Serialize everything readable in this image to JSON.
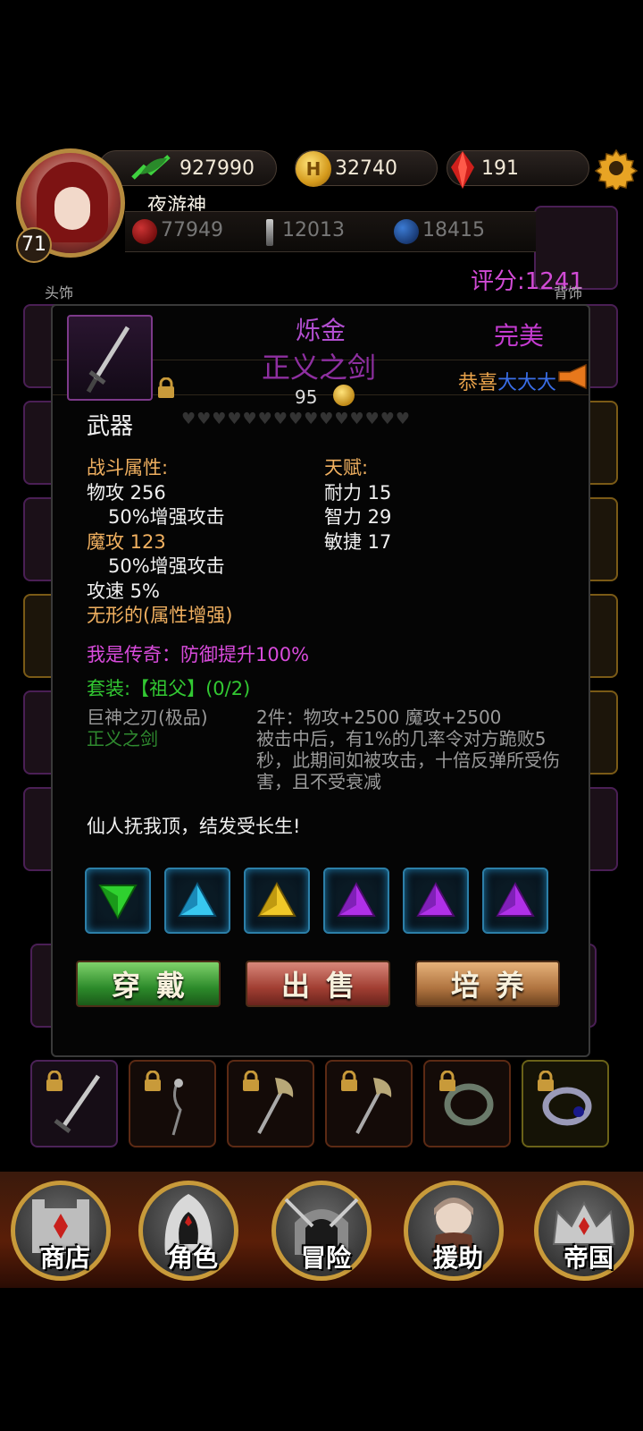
{
  "resources": {
    "exp": "927990",
    "gold": "32740",
    "gold_icon_letter": "H",
    "gems": "191"
  },
  "player": {
    "name": "夜游神",
    "level": "71",
    "hp": "77949",
    "attack": "12013",
    "mana": "18415",
    "score": "评分:1241"
  },
  "slot_labels": {
    "head": "头饰",
    "back": "背饰"
  },
  "item": {
    "type_top": "烁金",
    "name": "正义之剑",
    "quality": "完美",
    "congrats_prefix": "恭喜",
    "congrats_name": "大大大",
    "level_req": "95",
    "slot_type": "武器",
    "hearts": "♥♥♥♥♥♥♥♥♥♥♥♥♥♥♥",
    "combat_title": "战斗属性:",
    "combat_stats": [
      {
        "text": "物攻 256",
        "style": "white"
      },
      {
        "text": "50%增强攻击",
        "style": "white indent"
      },
      {
        "text": "魔攻 123",
        "style": "orange"
      },
      {
        "text": "50%增强攻击",
        "style": "white indent"
      },
      {
        "text": "攻速 5%",
        "style": "white"
      },
      {
        "text": "无形的(属性增强)",
        "style": "orange"
      }
    ],
    "talent_title": "天赋:",
    "talents": [
      "耐力 15",
      "智力 29",
      "敏捷 17"
    ],
    "legend_line": "我是传奇：防御提升100%",
    "set_line": "套装:【祖父】(0/2)",
    "set_item_1": "巨神之刃(极品)",
    "set_item_2": "正义之剑",
    "set_effect": "2件：物攻+2500 魔攻+2500\n被击中后，有1%的几率令对方跪败5秒，此期间如被攻击，十倍反弹所受伤害，且不受衰减",
    "flavor": "仙人抚我顶，结发受长生!",
    "gems": [
      {
        "color": "green",
        "fill": "#2fd12f"
      },
      {
        "color": "cyan",
        "fill": "#38c8f0"
      },
      {
        "color": "yellow",
        "fill": "#f0c828"
      },
      {
        "color": "purple",
        "fill": "#b030e8"
      },
      {
        "color": "purple",
        "fill": "#b030e8"
      },
      {
        "color": "purple",
        "fill": "#b030e8"
      }
    ]
  },
  "buttons": {
    "equip": "穿戴",
    "sell": "出售",
    "train": "培养"
  },
  "nav": {
    "shop": "商店",
    "character": "角色",
    "adventure": "冒险",
    "assist": "援助",
    "empire": "帝国"
  },
  "colors": {
    "score": "#d24bd6",
    "quality": "#c43bd0",
    "set": "#32c832",
    "legend": "#d94bdc"
  }
}
